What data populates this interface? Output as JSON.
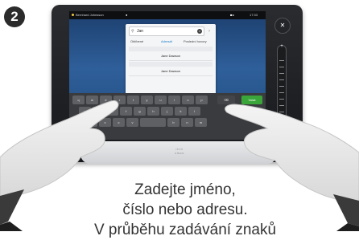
{
  "step": {
    "number": "2"
  },
  "statusbar": {
    "user": "Bernhard Johnsson",
    "clock": "17:33"
  },
  "search": {
    "query": "Jan",
    "tabs": [
      "Oblíbené",
      "Adresář",
      "Poslední hovory"
    ],
    "active_tab_index": 1,
    "results": [
      "Jane Dawson",
      "Jane Dawson"
    ]
  },
  "keyboard": {
    "row1": [
      "q",
      "w",
      "e",
      "r",
      "t",
      "y",
      "u",
      "i",
      "o",
      "p"
    ],
    "row2": [
      "a",
      "s",
      "d",
      "f",
      "g",
      "h",
      "j",
      "k",
      "l"
    ],
    "row3": [
      "z",
      "x",
      "c",
      "v",
      "b",
      "n",
      "m"
    ],
    "enter_label": "Volat",
    "accent_color": "#3aa63a"
  },
  "device": {
    "brand": "cisco"
  },
  "caption": {
    "line1": "Zadejte jméno,",
    "line2": "číslo nebo adresu.",
    "line3": "V průběhu zadávání znaků"
  }
}
